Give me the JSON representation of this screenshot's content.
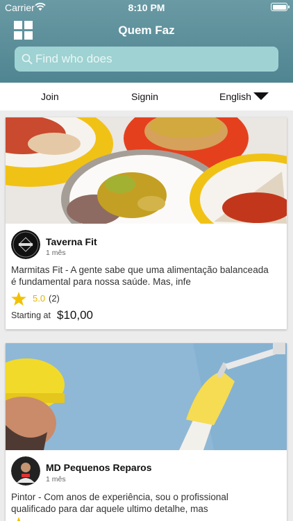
{
  "status_bar": {
    "carrier": "Carrier",
    "time": "8:10 PM"
  },
  "header": {
    "title": "Quem Faz",
    "menu_icon": "grid-icon"
  },
  "search": {
    "placeholder": "Find who does",
    "icon": "search-icon"
  },
  "nav": {
    "join": "Join",
    "signin": "Signin",
    "language": "English"
  },
  "listings": [
    {
      "name": "Taverna Fit",
      "age": "1 mês",
      "description_lines": [
        "Marmitas Fit - A gente sabe que uma alimentação balanceada",
        "é fundamental para nossa saúde. Mas, infe"
      ],
      "rating": "5.0",
      "reviews": "(2)",
      "starting_label": "Starting at",
      "price": "$10,00"
    },
    {
      "name": "MD Pequenos Reparos",
      "age": "1 mês",
      "description_lines": [
        "Pintor - Com anos de experiência, sou o profissional",
        "qualificado para dar aquele ultimo detalhe, mas"
      ]
    }
  ],
  "colors": {
    "header": "#5b8f99",
    "search_bg": "#9fd2d2",
    "star": "#f2c200"
  }
}
